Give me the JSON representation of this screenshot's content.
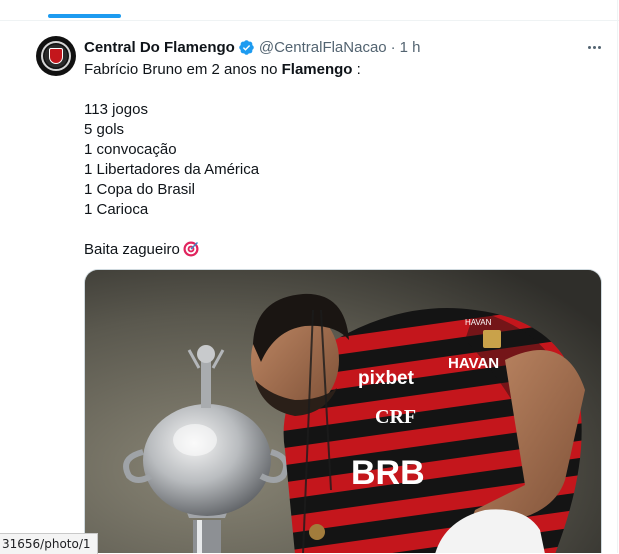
{
  "tweet": {
    "author_name": "Central Do Flamengo",
    "handle": "@CentralFlaNacao",
    "separator": "·",
    "time": "1 h",
    "line1_pre": "Fabrício Bruno em 2 anos no ",
    "line1_bold": "Flamengo",
    "line1_post": " :",
    "stats": [
      "113 jogos",
      "5 gols",
      "1 convocação",
      "1 Libertadores da América",
      "1 Copa do Brasil",
      "1 Carioca"
    ],
    "closing": "Baita zagueiro",
    "closing_emoji": "direct-hit-icon"
  },
  "media": {
    "jersey_sponsor": "pixbet",
    "jersey_bank": "BRB",
    "sleeve_text_1": "HAVAN",
    "sleeve_text_2": "HAVAN",
    "club_monogram": "CRF"
  },
  "colors": {
    "accent": "#1d9bf0",
    "text_primary": "#0f1419",
    "text_secondary": "#536471",
    "flamengo_red": "#c4161c"
  },
  "status_bar": {
    "url": "31656/photo/1"
  }
}
